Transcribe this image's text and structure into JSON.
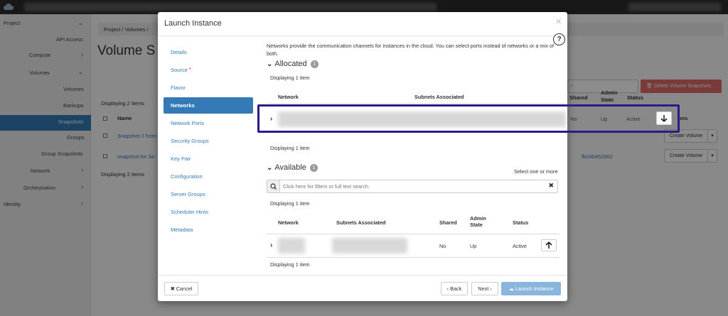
{
  "sidebar": {
    "items": [
      {
        "label": "Project",
        "chevron": "v"
      },
      {
        "label": "API Access"
      },
      {
        "label": "Compute",
        "chevron": ">"
      },
      {
        "label": "Volumes",
        "chevron": "v"
      },
      {
        "label": "Volumes"
      },
      {
        "label": "Backups"
      },
      {
        "label": "Snapshots",
        "active": true
      },
      {
        "label": "Groups"
      },
      {
        "label": "Group Snapshots"
      },
      {
        "label": "Network",
        "chevron": ">"
      },
      {
        "label": "Orchestration",
        "chevron": ">"
      },
      {
        "label": "Identity",
        "chevron": ">"
      }
    ]
  },
  "background": {
    "breadcrumb": "Project  /  Volumes  /",
    "page_title": "Volume S",
    "displaying_top": "Displaying 2 items",
    "displaying_bottom": "Displaying 2 items",
    "col_name": "Name",
    "col_shared": "Shared",
    "col_admin_state": "Admin State",
    "col_status": "Status",
    "col_actions": "ons",
    "filter_placeholder": "r",
    "delete_button": "Delete Volume Snapshots",
    "row1_name": "Snapshot 2 from",
    "row2_name": "snapshot for Sn",
    "row2_id": "fb04b952962",
    "create_volume_button": "Create Volume"
  },
  "modal": {
    "title": "Launch Instance",
    "close_icon": "×",
    "help_icon": "?",
    "nav": [
      {
        "label": "Details"
      },
      {
        "label": "Source",
        "required": "*"
      },
      {
        "label": "Flavor"
      },
      {
        "label": "Networks",
        "active": true
      },
      {
        "label": "Network Ports"
      },
      {
        "label": "Security Groups"
      },
      {
        "label": "Key Pair"
      },
      {
        "label": "Configuration"
      },
      {
        "label": "Server Groups"
      },
      {
        "label": "Scheduler Hints"
      },
      {
        "label": "Metadata"
      }
    ],
    "description": "Networks provide the communication channels for instances in the cloud. You can select ports instead of networks or a mix of both.",
    "allocated": {
      "heading": "Allocated",
      "count": "1",
      "displaying_top": "Displaying 1 item",
      "displaying_bottom": "Displaying 1 item",
      "columns": [
        "Network",
        "Subnets Associated",
        "Shared",
        "Admin State",
        "Status"
      ],
      "row": {
        "shared": "No",
        "admin_state": "Up",
        "status": "Active"
      }
    },
    "available": {
      "heading": "Available",
      "count": "1",
      "select_hint": "Select one or more",
      "search_placeholder": "Click here for filters or full text search.",
      "displaying_top": "Displaying 1 item",
      "displaying_bottom": "Displaying 1 item",
      "columns": [
        "Network",
        "Subnets Associated",
        "Shared",
        "Admin State",
        "Status"
      ],
      "row": {
        "shared": "No",
        "admin_state": "Up",
        "status": "Active"
      }
    },
    "footer": {
      "cancel": "Cancel",
      "back": "Back",
      "next": "Next",
      "launch": "Launch Instance"
    }
  },
  "colors": {
    "accent": "#337ab7",
    "highlight_border": "#2a1a8c",
    "danger": "#d9534f"
  }
}
